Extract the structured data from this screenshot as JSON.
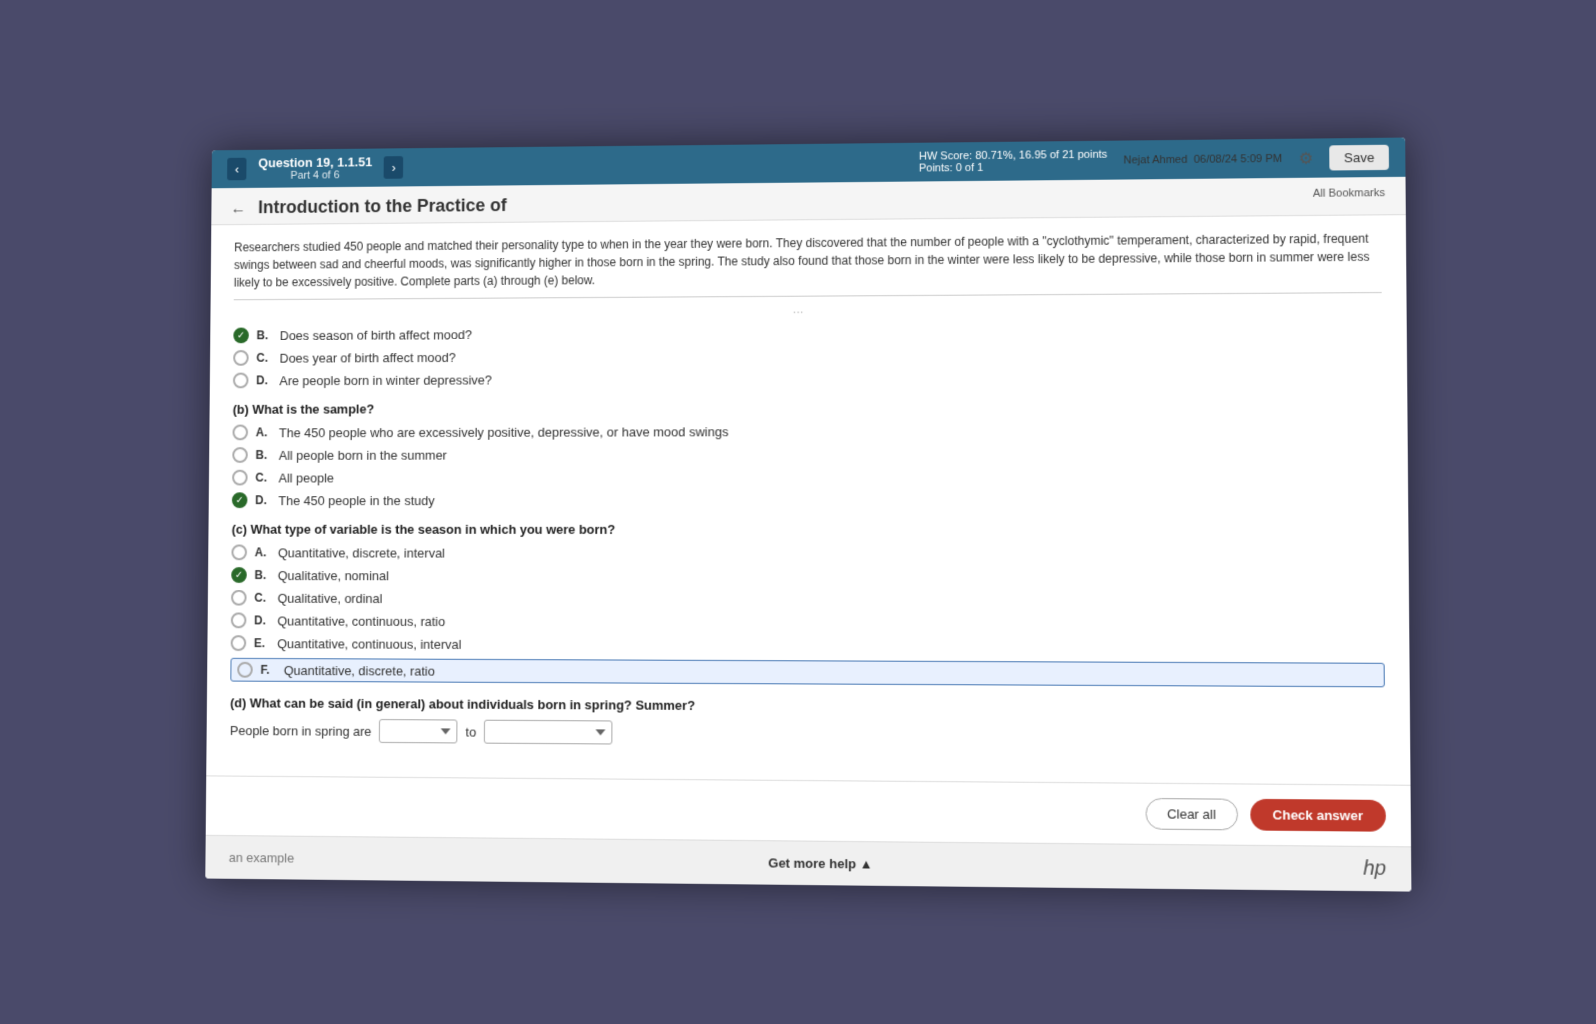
{
  "header": {
    "course_title": "Introduction to the Practice of",
    "question_label": "Question 19, 1.1.51",
    "part_label": "Part 4 of 6",
    "back_arrow": "‹",
    "forward_arrow": "›",
    "hw_score_label": "HW Score: 80.71%, 16.95 of 21 points",
    "points_label": "Points: 0 of 1",
    "user_name": "Nejat Ahmed",
    "date_time": "06/08/24 5:09 PM",
    "save_label": "Save",
    "all_bookmarks": "All Bookmarks"
  },
  "passage": "Researchers studied 450 people and matched their personality type to when in the year they were born. They discovered that the number of people with a \"cyclothymic\" temperament, characterized by rapid, frequent swings between sad and cheerful moods, was significantly higher in those born in the spring. The study also found that those born in the winter were less likely to be depressive, while those born in summer were less likely to be excessively positive. Complete parts (a) through (e) below.",
  "dots": "···",
  "parts": {
    "part_b": {
      "label": "(b) What is the sample?",
      "options": [
        {
          "letter": "A.",
          "text": "The 450 people who are excessively positive, depressive, or have mood swings",
          "checked": false
        },
        {
          "letter": "B.",
          "text": "All people born in the summer",
          "checked": false
        },
        {
          "letter": "C.",
          "text": "All people",
          "checked": false
        },
        {
          "letter": "D.",
          "text": "The 450 people in the study",
          "checked": true
        }
      ]
    },
    "part_a_visible": {
      "options_visible": [
        {
          "letter": "B.",
          "text": "Does season of birth affect mood?",
          "checked": true
        },
        {
          "letter": "C.",
          "text": "Does year of birth affect mood?",
          "checked": false
        },
        {
          "letter": "D.",
          "text": "Are people born in winter depressive?",
          "checked": false
        }
      ]
    },
    "part_c": {
      "label": "(c) What type of variable is the season in which you were born?",
      "options": [
        {
          "letter": "A.",
          "text": "Quantitative, discrete, interval",
          "checked": false
        },
        {
          "letter": "B.",
          "text": "Qualitative, nominal",
          "checked": true
        },
        {
          "letter": "C.",
          "text": "Qualitative, ordinal",
          "checked": false
        },
        {
          "letter": "D.",
          "text": "Quantitative, continuous, ratio",
          "checked": false
        },
        {
          "letter": "E.",
          "text": "Quantitative, continuous, interval",
          "checked": false
        },
        {
          "letter": "F.",
          "text": "Quantitative, discrete, ratio",
          "checked": false,
          "highlighted": true
        }
      ]
    },
    "part_d": {
      "label": "(d) What can be said (in general) about individuals born in spring? Summer?",
      "row_label": "People born in spring are",
      "dropdown1_placeholder": "▼",
      "to_label": "to",
      "dropdown2_placeholder": "▼"
    }
  },
  "actions": {
    "clear_all": "Clear all",
    "check_answer": "Check answer"
  },
  "bottom": {
    "example_label": "an example",
    "get_more_help": "Get more help ▲",
    "logo": "hp"
  }
}
